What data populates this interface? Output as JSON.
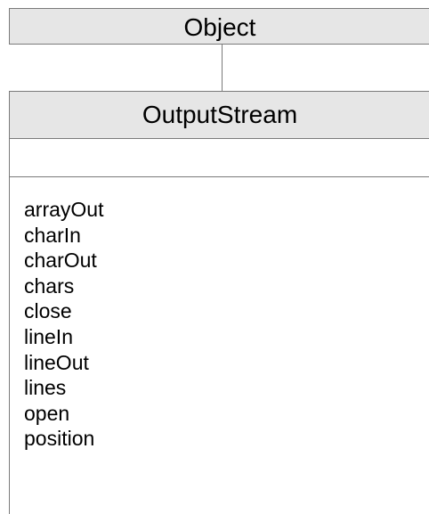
{
  "diagram": {
    "parent_class": {
      "name": "Object"
    },
    "child_class": {
      "name": "OutputStream",
      "attributes": [],
      "methods": [
        "arrayOut",
        "charIn",
        "charOut",
        "chars",
        "close",
        "lineIn",
        "lineOut",
        "lines",
        "open",
        "position"
      ]
    }
  }
}
